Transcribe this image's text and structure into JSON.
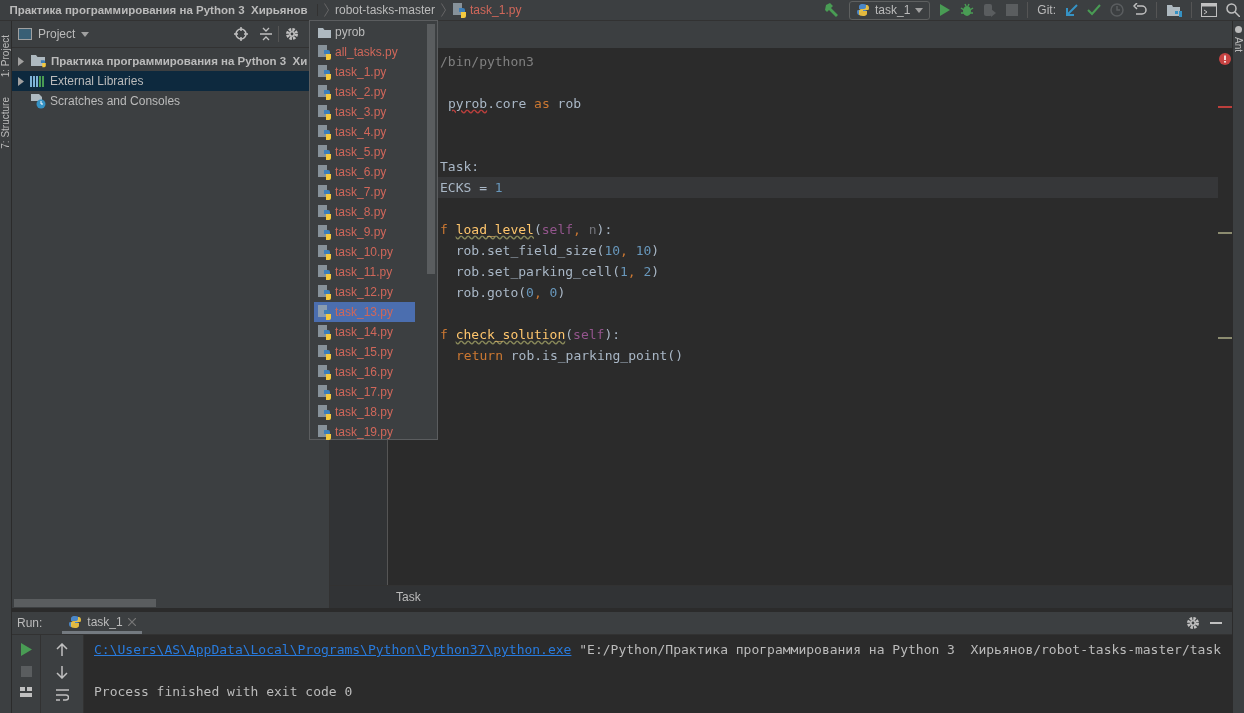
{
  "breadcrumbs": [
    {
      "label": "Практика программирования на Python 3  Хирьянов",
      "kind": "project"
    },
    {
      "label": "robot-tasks-master",
      "kind": "folder"
    },
    {
      "label": "task_1.py",
      "kind": "file"
    }
  ],
  "toolbar": {
    "run_config": "task_1",
    "git_label": "Git:"
  },
  "left_stripe": [
    "1: Project",
    "7: Structure"
  ],
  "right_stripe": [
    "Ant"
  ],
  "project_panel": {
    "title": "Project",
    "tree": [
      {
        "label": "Практика программирования на Python 3  Хи",
        "kind": "project",
        "expanded": false,
        "selected": false
      },
      {
        "label": "External Libraries",
        "kind": "libraries",
        "expanded": false,
        "selected": true
      },
      {
        "label": "Scratches and Consoles",
        "kind": "scratches",
        "selected": false
      }
    ]
  },
  "popup": {
    "items": [
      {
        "label": "pyrob",
        "kind": "folder",
        "selected": false
      },
      {
        "label": "all_tasks.py",
        "kind": "file",
        "selected": false
      },
      {
        "label": "task_1.py",
        "kind": "file",
        "selected": false
      },
      {
        "label": "task_2.py",
        "kind": "file",
        "selected": false
      },
      {
        "label": "task_3.py",
        "kind": "file",
        "selected": false
      },
      {
        "label": "task_4.py",
        "kind": "file",
        "selected": false
      },
      {
        "label": "task_5.py",
        "kind": "file",
        "selected": false
      },
      {
        "label": "task_6.py",
        "kind": "file",
        "selected": false
      },
      {
        "label": "task_7.py",
        "kind": "file",
        "selected": false
      },
      {
        "label": "task_8.py",
        "kind": "file",
        "selected": false
      },
      {
        "label": "task_9.py",
        "kind": "file",
        "selected": false
      },
      {
        "label": "task_10.py",
        "kind": "file",
        "selected": false
      },
      {
        "label": "task_11.py",
        "kind": "file",
        "selected": false
      },
      {
        "label": "task_12.py",
        "kind": "file",
        "selected": false
      },
      {
        "label": "task_13.py",
        "kind": "file",
        "selected": true
      },
      {
        "label": "task_14.py",
        "kind": "file",
        "selected": false
      },
      {
        "label": "task_15.py",
        "kind": "file",
        "selected": false
      },
      {
        "label": "task_16.py",
        "kind": "file",
        "selected": false
      },
      {
        "label": "task_17.py",
        "kind": "file",
        "selected": false
      },
      {
        "label": "task_18.py",
        "kind": "file",
        "selected": false
      },
      {
        "label": "task_19.py",
        "kind": "file",
        "selected": false
      }
    ]
  },
  "editor": {
    "lines": [
      {
        "kind": "code",
        "current": false,
        "segments": [
          {
            "text": "/bin/python3",
            "kind": "comment"
          }
        ]
      },
      {
        "kind": "blank",
        "current": false
      },
      {
        "kind": "code_offset",
        "current": false,
        "segments": [
          {
            "text": "pyrob",
            "kind": "unresolved"
          },
          {
            "text": ".core ",
            "kind": "plain"
          },
          {
            "text": "as",
            "kind": "keyword"
          },
          {
            "text": " rob",
            "kind": "plain"
          }
        ]
      },
      {
        "kind": "blank",
        "current": false
      },
      {
        "kind": "blank",
        "current": false
      },
      {
        "kind": "code",
        "current": false,
        "segments": [
          {
            "text": "Task:",
            "kind": "plain"
          }
        ]
      },
      {
        "kind": "code",
        "current": true,
        "segments": [
          {
            "text": "ECKS = ",
            "kind": "plain"
          },
          {
            "text": "1",
            "kind": "number"
          }
        ]
      },
      {
        "kind": "blank",
        "current": false
      },
      {
        "kind": "code",
        "current": false,
        "segments": [
          {
            "text": "f ",
            "kind": "keyword"
          },
          {
            "text": "load_level",
            "kind": "function"
          },
          {
            "text": "(",
            "kind": "plain"
          },
          {
            "text": "self",
            "kind": "self"
          },
          {
            "text": ", ",
            "kind": "keyword"
          },
          {
            "text": "n",
            "kind": "unused"
          },
          {
            "text": "):",
            "kind": "plain"
          }
        ]
      },
      {
        "kind": "code",
        "current": false,
        "segments": [
          {
            "text": "  rob.set_field_size(",
            "kind": "plain"
          },
          {
            "text": "10",
            "kind": "number"
          },
          {
            "text": ", ",
            "kind": "keyword"
          },
          {
            "text": "10",
            "kind": "number"
          },
          {
            "text": ")",
            "kind": "plain"
          }
        ]
      },
      {
        "kind": "code",
        "current": false,
        "segments": [
          {
            "text": "  rob.set_parking_cell(",
            "kind": "plain"
          },
          {
            "text": "1",
            "kind": "number"
          },
          {
            "text": ", ",
            "kind": "keyword"
          },
          {
            "text": "2",
            "kind": "number"
          },
          {
            "text": ")",
            "kind": "plain"
          }
        ]
      },
      {
        "kind": "code",
        "current": false,
        "segments": [
          {
            "text": "  rob.goto(",
            "kind": "plain"
          },
          {
            "text": "0",
            "kind": "number"
          },
          {
            "text": ", ",
            "kind": "keyword"
          },
          {
            "text": "0",
            "kind": "number"
          },
          {
            "text": ")",
            "kind": "plain"
          }
        ]
      },
      {
        "kind": "blank",
        "current": false
      },
      {
        "kind": "code",
        "current": false,
        "segments": [
          {
            "text": "f ",
            "kind": "keyword"
          },
          {
            "text": "check_solution",
            "kind": "function"
          },
          {
            "text": "(",
            "kind": "plain"
          },
          {
            "text": "self",
            "kind": "self"
          },
          {
            "text": "):",
            "kind": "plain"
          }
        ]
      },
      {
        "kind": "code_indented",
        "current": false,
        "segments": [
          {
            "text": "return",
            "kind": "keyword"
          },
          {
            "text": " rob.is_parking_point()",
            "kind": "plain"
          }
        ]
      }
    ],
    "breadcrumb": "Task"
  },
  "run_panel": {
    "label": "Run:",
    "tabs": [
      {
        "label": "task_1",
        "selected": true
      }
    ],
    "console": [
      {
        "kind": "text",
        "segments": [
          {
            "text": "C:\\Users\\AS\\AppData\\Local\\Programs\\Python\\Python37\\python.exe",
            "kind": "link"
          },
          {
            "text": " \"E:/Python/Практика программирования на Python 3  Хирьянов/robot-tasks-master/task",
            "kind": "plain"
          }
        ]
      },
      {
        "kind": "blank"
      },
      {
        "kind": "text",
        "segments": [
          {
            "text": "Process finished with exit code 0",
            "kind": "plain"
          }
        ]
      }
    ]
  }
}
